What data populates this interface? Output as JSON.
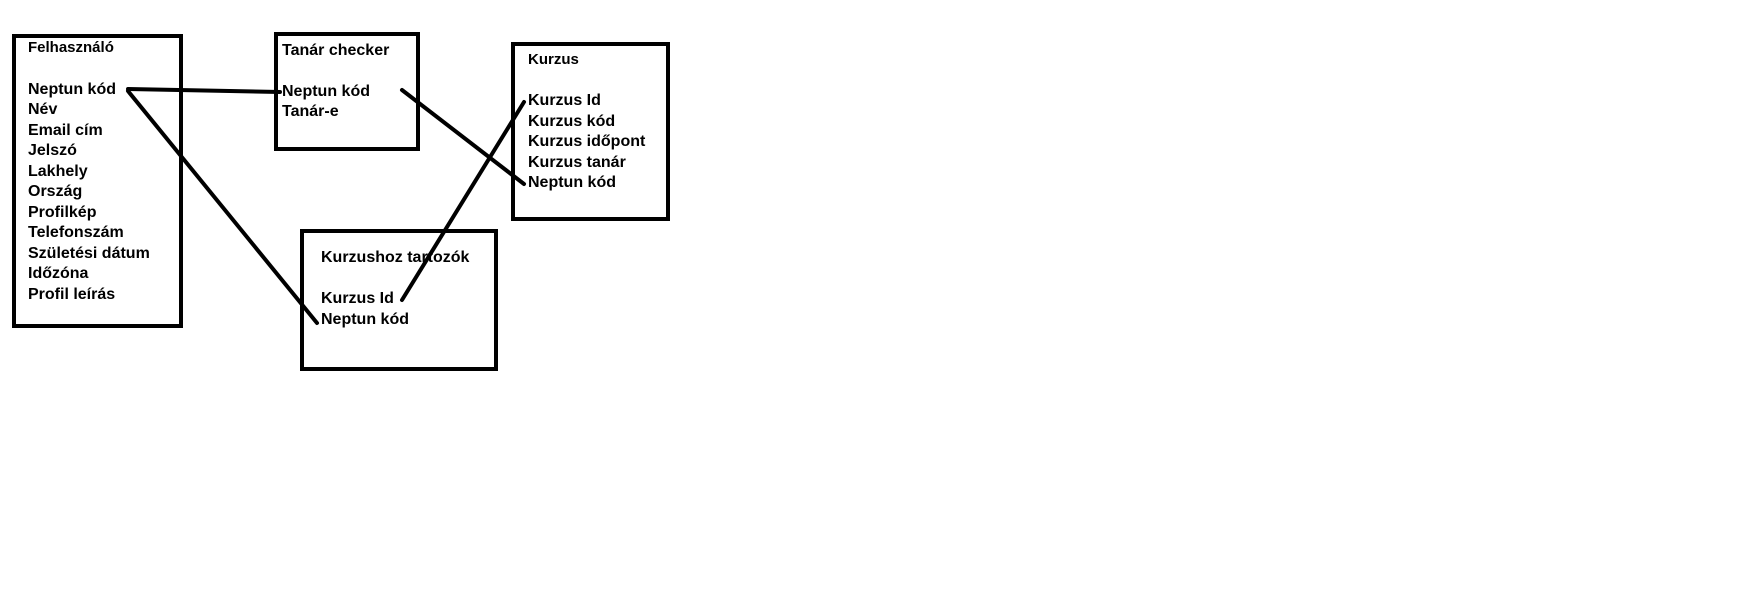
{
  "entities": {
    "felhasznalo": {
      "title": "Felhasználó",
      "fields": [
        "Neptun kód",
        "Név",
        "Email cím",
        "Jelszó",
        "Lakhely",
        "Ország",
        "Profilkép",
        "Telefonszám",
        "Születési dátum",
        "Időzóna",
        "Profil leírás"
      ]
    },
    "tanar_checker": {
      "title": "Tanár checker",
      "fields": [
        "Neptun kód",
        "Tanár-e"
      ]
    },
    "kurzus": {
      "title": "Kurzus",
      "fields": [
        "Kurzus Id",
        "Kurzus kód",
        "Kurzus időpont",
        "Kurzus tanár",
        "Neptun kód"
      ]
    },
    "kurzushoz_tartozok": {
      "title": "Kurzushoz tartozók",
      "fields": [
        "Kurzus Id",
        "Neptun kód"
      ]
    }
  }
}
